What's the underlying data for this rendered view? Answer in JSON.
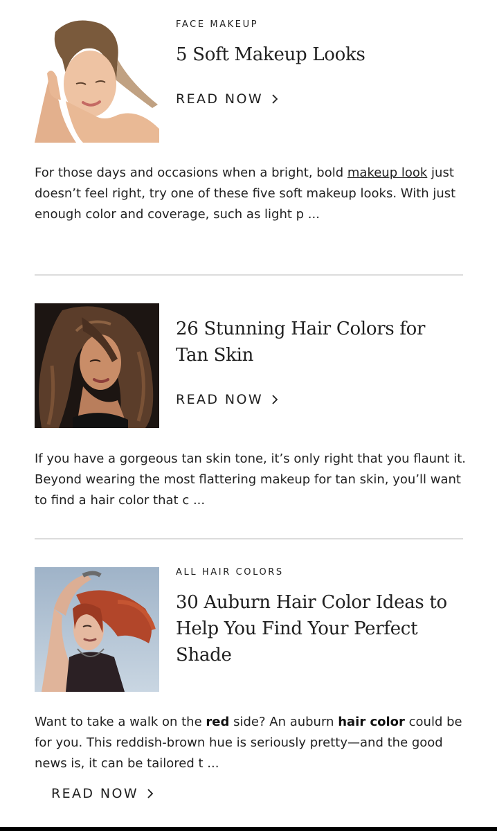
{
  "articles": [
    {
      "category": "FACE MAKEUP",
      "title": "5 Soft Makeup Looks",
      "read_now": "READ NOW",
      "excerpt": {
        "before_link": "For those days and occasions when a bright, bold ",
        "link_text": "makeup look",
        "after_link": " just doesn’t feel right, try one of these five soft makeup looks. With just enough color and coverage, such as light p ..."
      }
    },
    {
      "category": "",
      "title_lines": [
        "26 Stunning Hair Colors for",
        "Tan Skin"
      ],
      "read_now": "READ NOW",
      "excerpt_text": "If you have a gorgeous tan skin tone, it’s only right that you flaunt it. Beyond wearing the most flattering makeup for tan skin, you’ll want to find a hair color that c ..."
    },
    {
      "category": "ALL HAIR COLORS",
      "title_lines": [
        "30 Auburn Hair Color Ideas to",
        "Help You Find Your Perfect",
        "Shade"
      ],
      "read_now": "READ NOW",
      "excerpt": {
        "p1": "Want to take a walk on the ",
        "bold1": "red",
        "p2": " side? An auburn ",
        "bold2": "hair color",
        "p3": " could be for you. This reddish-brown hue is seriously pretty—and the good news is, it can be tailored t ..."
      }
    }
  ],
  "colors": {
    "text": "#1f1f1f",
    "divider": "#dcdcdc",
    "bottom_bar": "#000000"
  },
  "icons": [
    "chevron-right-icon"
  ]
}
